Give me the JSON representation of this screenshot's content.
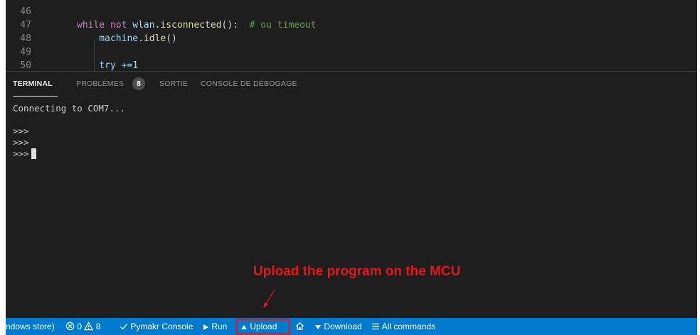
{
  "editor": {
    "lines": [
      {
        "num": "46",
        "parts": []
      },
      {
        "num": "47",
        "parts": [
          {
            "text": "while",
            "cls": "kw"
          },
          {
            "text": " not ",
            "cls": "kw"
          },
          {
            "text": "wlan",
            "cls": "var"
          },
          {
            "text": ".",
            "cls": "txt"
          },
          {
            "text": "isconnected",
            "cls": "fn"
          },
          {
            "text": "():  ",
            "cls": "txt"
          },
          {
            "text": "# ou timeout",
            "cls": "cm"
          }
        ]
      },
      {
        "num": "48",
        "parts": [
          {
            "text": "    machine",
            "cls": "var"
          },
          {
            "text": ".",
            "cls": "txt"
          },
          {
            "text": "idle",
            "cls": "fn"
          },
          {
            "text": "()",
            "cls": "txt"
          }
        ]
      },
      {
        "num": "49",
        "parts": []
      },
      {
        "num": "50",
        "parts": [
          {
            "text": "    try +=1",
            "cls": "var"
          }
        ]
      }
    ]
  },
  "panel": {
    "tabs": [
      {
        "label": "TERMINAL",
        "active": true
      },
      {
        "label": "PROBLÈMES",
        "active": false
      },
      {
        "label": "SORTIE",
        "active": false
      },
      {
        "label": "CONSOLE DE DÉBOGAGE",
        "active": false
      }
    ],
    "problems_count": "8",
    "terminal_lines": [
      "Connecting to COM7...",
      "",
      ">>>",
      ">>>",
      ">>>"
    ]
  },
  "annotation": {
    "text": "Upload the program on the MCU",
    "color": "#e8141c"
  },
  "statusbar": {
    "background": "#007acc",
    "interpreter": "ndows store)",
    "errors": "0",
    "warnings": "8",
    "pymakr_console": "Pymakr Console",
    "run": "Run",
    "upload": "Upload",
    "download": "Download",
    "all_commands": "All commands"
  }
}
